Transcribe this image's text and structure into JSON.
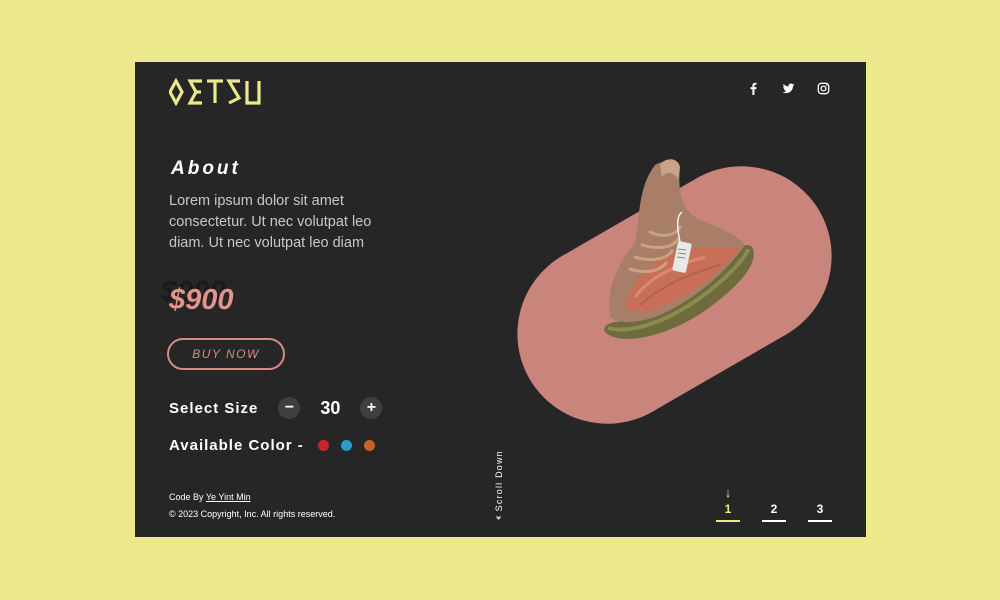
{
  "header": {
    "logo_text": "OETSU",
    "social": [
      "facebook-icon",
      "twitter-icon",
      "instagram-icon"
    ]
  },
  "about": {
    "title": "About",
    "text": "Lorem ipsum dolor sit amet consectetur. Ut nec volutpat leo diam.  Ut nec volutpat leo diam"
  },
  "product": {
    "price": "$900",
    "buy_label": "BUY NOW",
    "size_label": "Select Size",
    "size_value": "30",
    "minus_label": "−",
    "plus_label": "+",
    "color_label": "Available Color -",
    "colors": [
      "#C8242A",
      "#2A9AC9",
      "#C8622A"
    ]
  },
  "footer": {
    "credit_prefix": "Code By",
    "credit_author": "Ye Yint Min",
    "copyright": "© 2023 Copyright, Inc. All rights reserved."
  },
  "scroll": {
    "label": "Scroll Down"
  },
  "pagination": {
    "pages": [
      "1",
      "2",
      "3"
    ],
    "active_index": 0
  },
  "colors": {
    "background": "#ECE98D",
    "card": "#262626",
    "accent_pink": "#C9857C",
    "price": "#E2938A",
    "logo": "#ECE98D"
  }
}
